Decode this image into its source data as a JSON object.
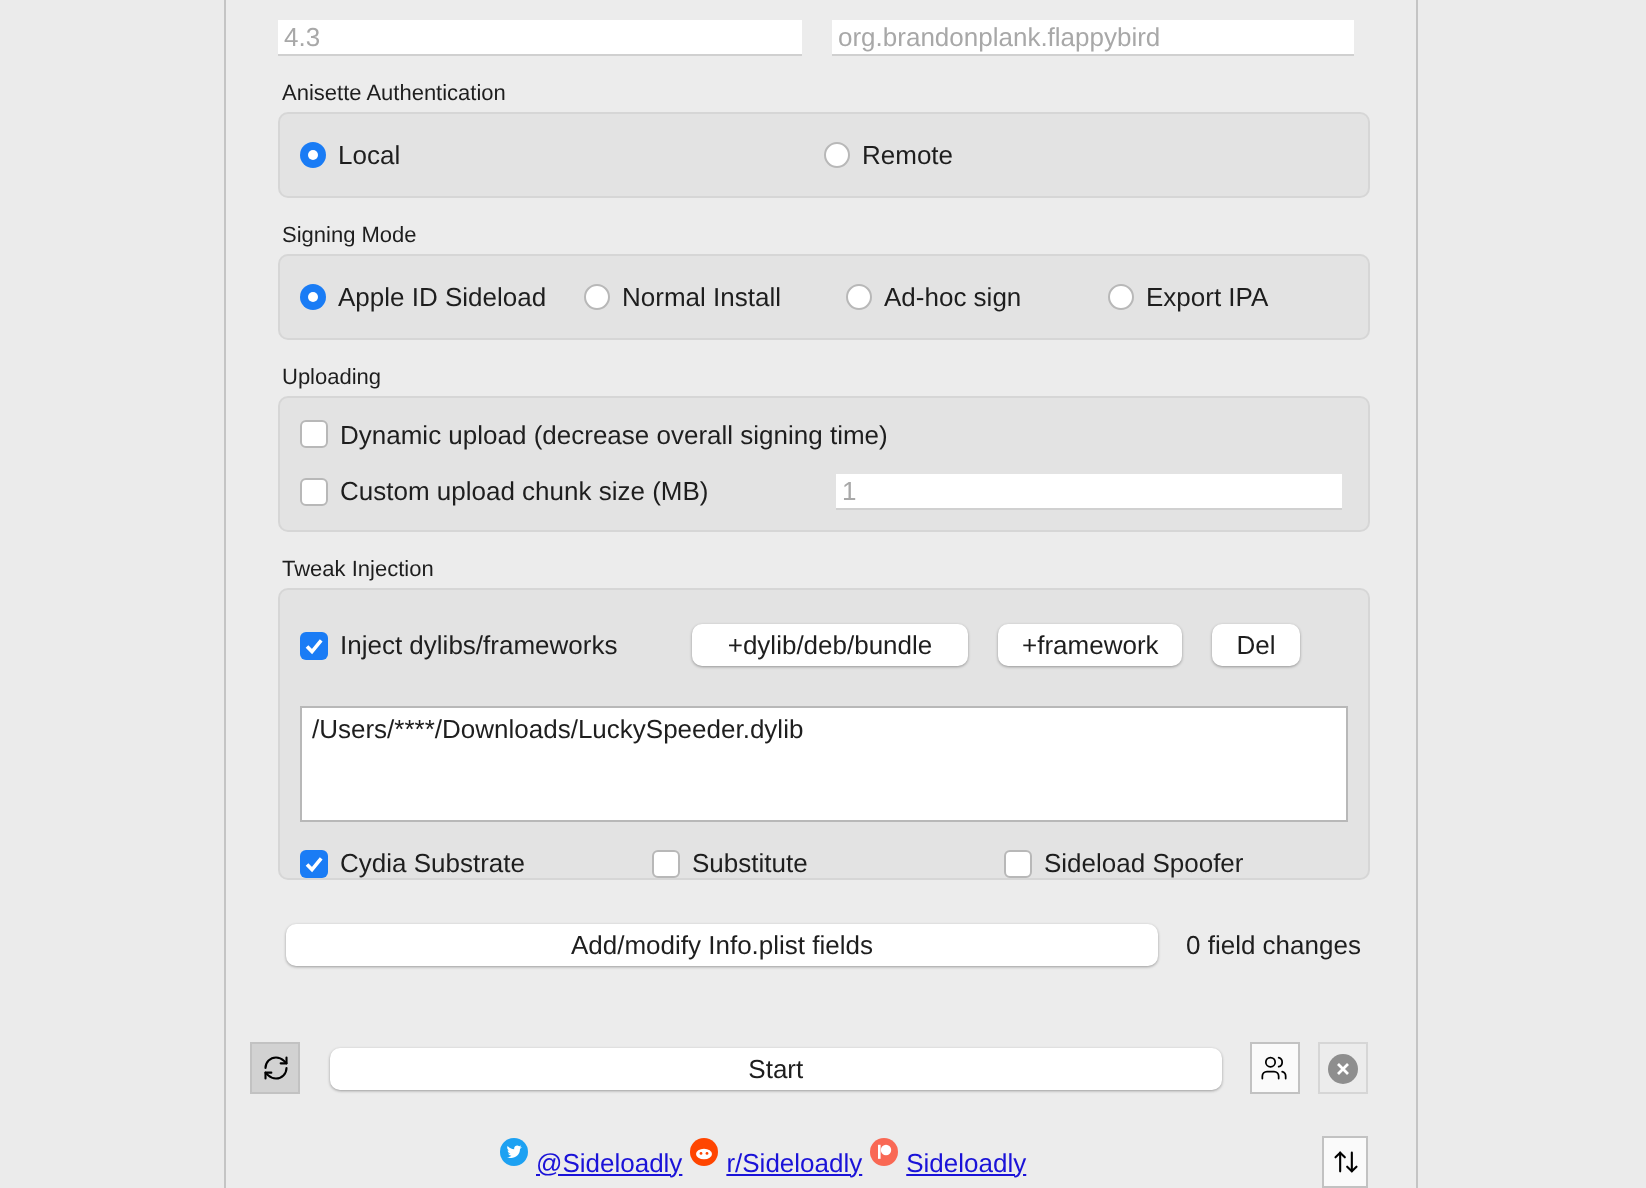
{
  "top_fields": [
    {
      "value": "4.3",
      "disabled": true
    },
    {
      "value": "org.brandonplank.flappybird",
      "disabled": true
    }
  ],
  "anisette": {
    "title": "Anisette Authentication",
    "options": [
      {
        "label": "Local",
        "selected": true
      },
      {
        "label": "Remote",
        "selected": false
      }
    ]
  },
  "signing_mode": {
    "title": "Signing Mode",
    "options": [
      {
        "label": "Apple ID Sideload",
        "selected": true
      },
      {
        "label": "Normal Install",
        "selected": false
      },
      {
        "label": "Ad-hoc sign",
        "selected": false
      },
      {
        "label": "Export IPA",
        "selected": false
      }
    ]
  },
  "uploading": {
    "title": "Uploading",
    "options": [
      {
        "label": "Dynamic upload (decrease overall signing time)",
        "checked": false
      },
      {
        "label": "Custom upload chunk size (MB)",
        "checked": false
      }
    ],
    "chunk_field": {
      "value": "1",
      "disabled": true
    }
  },
  "tweak_injection": {
    "title": "Tweak Injection",
    "inject": {
      "label": "Inject dylibs/frameworks",
      "checked": true
    },
    "buttons": [
      "+dylib/deb/bundle",
      "+framework",
      "Del"
    ],
    "files": [
      "/Users/****/Downloads/LuckySpeeder.dylib"
    ],
    "options": [
      {
        "label": "Cydia Substrate",
        "checked": true
      },
      {
        "label": "Substitute",
        "checked": false
      },
      {
        "label": "Sideload Spoofer",
        "checked": false
      }
    ]
  },
  "plist": {
    "button": "Add/modify Info.plist fields",
    "changes": "0 field changes"
  },
  "start_button": "Start",
  "links": [
    {
      "label": "@Sideloadly",
      "kind": "twitter"
    },
    {
      "label": "r/Sideloadly",
      "kind": "reddit"
    },
    {
      "label": "Sideloadly",
      "kind": "patreon"
    }
  ]
}
